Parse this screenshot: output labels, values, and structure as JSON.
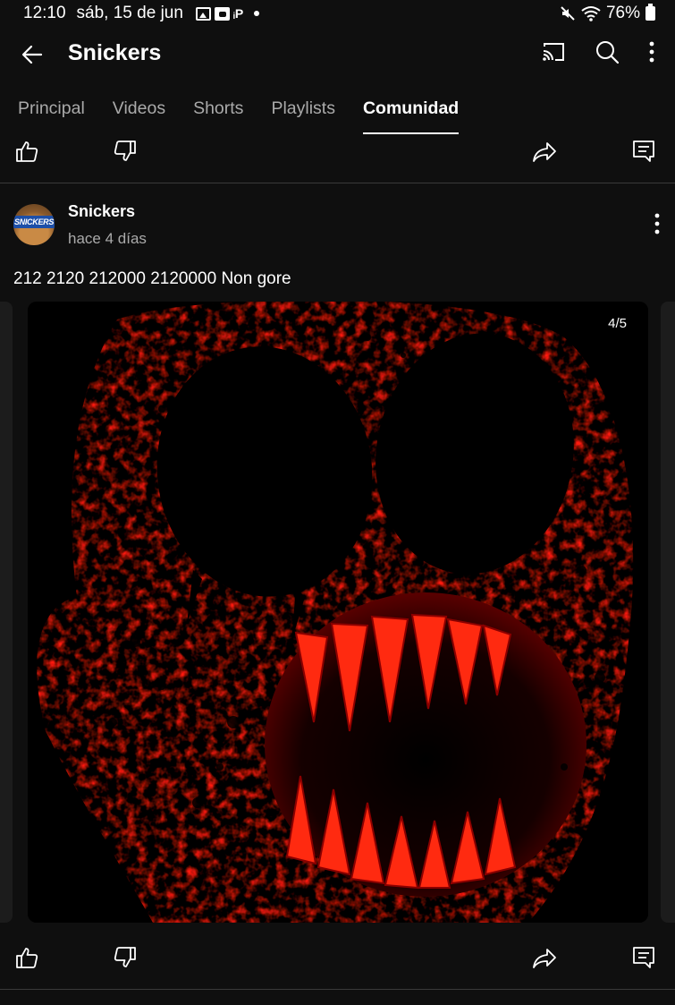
{
  "status_bar": {
    "time": "12:10",
    "date": "sáb, 15 de jun",
    "battery": "76%",
    "notification_icons": [
      "image-notification-icon",
      "face-notification-icon",
      "p-notification-icon"
    ],
    "indicator_icons": [
      "mute-icon",
      "wifi-icon",
      "battery-icon"
    ]
  },
  "appbar": {
    "title": "Snickers",
    "actions": [
      "cast-icon",
      "search-icon",
      "more-vert-icon"
    ]
  },
  "tabs": [
    {
      "label": "Principal",
      "active": false
    },
    {
      "label": "Videos",
      "active": false
    },
    {
      "label": "Shorts",
      "active": false
    },
    {
      "label": "Playlists",
      "active": false
    },
    {
      "label": "Comunidad",
      "active": true
    }
  ],
  "post": {
    "author": "Snickers",
    "avatar_label": "SNICKERS",
    "time": "hace 4 días",
    "text": "212 2120 212000 2120000  Non gore",
    "image_counter": "4/5",
    "image_description_icon": "red-skull-face-image"
  },
  "colors": {
    "background": "#0f0f0f",
    "image_red": "#ff1a0a",
    "secondary_text": "#aaaaaa"
  }
}
